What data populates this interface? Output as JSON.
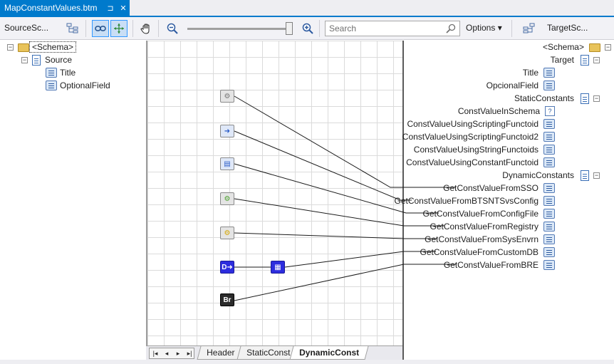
{
  "tab": {
    "title": "MapConstantValues.btm",
    "pin_glyph": "⊐",
    "close_glyph": "✕"
  },
  "toolbar": {
    "source_label": "SourceSc...",
    "target_label": "TargetSc...",
    "search_placeholder": "Search",
    "options_label": "Options ▾"
  },
  "source_tree": [
    {
      "label": "<Schema>",
      "type": "folder",
      "expander": "⊟",
      "selected": true
    },
    {
      "label": "Source",
      "type": "doc",
      "expander": "⊟"
    },
    {
      "label": "Title",
      "type": "field"
    },
    {
      "label": "OptionalField",
      "type": "field"
    }
  ],
  "target_tree": [
    {
      "label": "<Schema>",
      "type": "folder",
      "expander": "⊟"
    },
    {
      "label": "Target",
      "type": "doc",
      "expander": "⊟"
    },
    {
      "label": "Title",
      "type": "field"
    },
    {
      "label": "OpcionalField",
      "type": "field"
    },
    {
      "label": "StaticConstants",
      "type": "doc",
      "expander": "⊟"
    },
    {
      "label": "ConstValueInSchema",
      "type": "attr"
    },
    {
      "label": "ConstValueUsingScriptingFunctoid",
      "type": "field"
    },
    {
      "label": "ConstValueUsingScriptingFunctoid2",
      "type": "field"
    },
    {
      "label": "ConstValueUsingStringFunctoids",
      "type": "field"
    },
    {
      "label": "ConstValueUsingConstantFunctoid",
      "type": "field"
    },
    {
      "label": "DynamicConstants",
      "type": "doc",
      "expander": "⊟"
    },
    {
      "label": "GetConstValueFromSSO",
      "type": "field"
    },
    {
      "label": "GetConstValueFromBTSNTSvsConfig",
      "type": "field"
    },
    {
      "label": "GetConstValueFromConfigFile",
      "type": "field"
    },
    {
      "label": "GetConstValueFromRegistry",
      "type": "field"
    },
    {
      "label": "GetConstValueFromSysEnvrn",
      "type": "field"
    },
    {
      "label": "GetConstValueFromCustomDB",
      "type": "field"
    },
    {
      "label": "GetConstValueFromBRE",
      "type": "field"
    }
  ],
  "functoids": [
    {
      "name": "sso-functoid",
      "style": "gray",
      "glyph": "⚙"
    },
    {
      "name": "btsntsvc-functoid",
      "style": "blue",
      "glyph": "➜"
    },
    {
      "name": "config-file-functoid",
      "style": "blue",
      "glyph": "▤"
    },
    {
      "name": "registry-functoid",
      "style": "green",
      "glyph": "⚙"
    },
    {
      "name": "sysenv-functoid",
      "style": "yellow",
      "glyph": "⚙"
    },
    {
      "name": "customdb-functoid",
      "style": "db",
      "glyph": "D➜"
    },
    {
      "name": "db-lookup-functoid",
      "style": "db",
      "glyph": "▦"
    },
    {
      "name": "bre-functoid",
      "style": "br",
      "glyph": "Br"
    }
  ],
  "page_tabs": [
    {
      "label": "Header",
      "active": false
    },
    {
      "label": "StaticConst",
      "active": false
    },
    {
      "label": "DynamicConst",
      "active": true
    }
  ],
  "nav_buttons": [
    "|◂",
    "◂",
    "▸",
    "▸|"
  ]
}
